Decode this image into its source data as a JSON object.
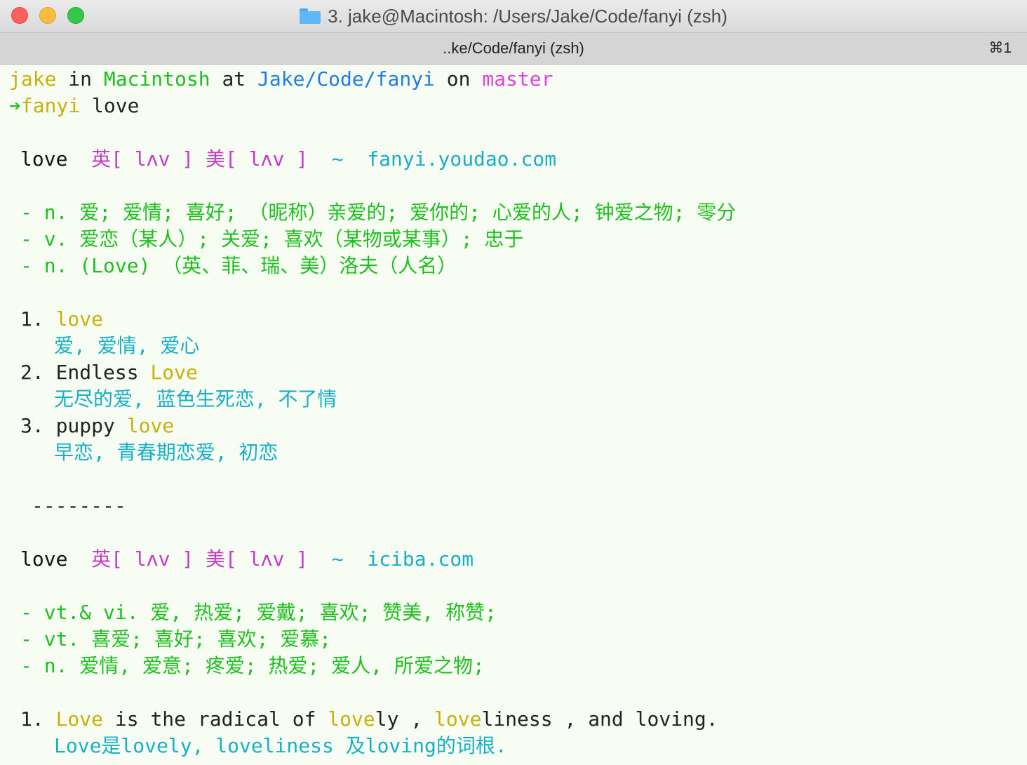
{
  "window": {
    "title": "3. jake@Macintosh: /Users/Jake/Code/fanyi (zsh)",
    "tab_title": "..ke/Code/fanyi (zsh)",
    "tab_shortcut": "⌘1"
  },
  "prompt": {
    "user": "jake",
    "in": "in",
    "host": "Macintosh",
    "at": "at",
    "path": "Jake/Code/fanyi",
    "on": "on",
    "branch": "master",
    "arrow": "➔",
    "command": "fanyi",
    "argument": "love"
  },
  "youdao": {
    "word": "love",
    "phonetic": "英[ lʌv ] 美[ lʌv ]",
    "tilde": "~",
    "source": "fanyi.youdao.com",
    "definitions": [
      "- n. 爱; 爱情; 喜好; （昵称）亲爱的; 爱你的; 心爱的人; 钟爱之物; 零分",
      "- v. 爱恋（某人）; 关爱; 喜欢（某物或某事）; 忠于",
      "- n. (Love) （英、菲、瑞、美）洛夫（人名）"
    ],
    "phrases": [
      {
        "num": "1.",
        "pre": "",
        "hl": "love",
        "post": "",
        "trans": "爱, 爱情, 爱心"
      },
      {
        "num": "2.",
        "pre": "Endless ",
        "hl": "Love",
        "post": "",
        "trans": "无尽的爱, 蓝色生死恋, 不了情"
      },
      {
        "num": "3.",
        "pre": "puppy ",
        "hl": "love",
        "post": "",
        "trans": "早恋, 青春期恋爱, 初恋"
      }
    ]
  },
  "separator": "--------",
  "iciba": {
    "word": "love",
    "phonetic": "英[ lʌv ] 美[ lʌv ]",
    "tilde": "~",
    "source": "iciba.com",
    "definitions": [
      "- vt.& vi. 爱, 热爱; 爱戴; 喜欢; 赞美, 称赞;",
      "- vt. 喜爱; 喜好; 喜欢; 爱慕;",
      "- n. 爱情, 爱意; 疼爱; 热爱; 爱人, 所爱之物;"
    ],
    "sentence": {
      "num": "1.",
      "hl1": "Love",
      "t1": " is the radical of ",
      "hl2": "love",
      "t2": "ly , ",
      "hl3": "love",
      "t3": "liness , and loving.",
      "trans": "Love是lovely, loveliness 及loving的词根."
    }
  }
}
